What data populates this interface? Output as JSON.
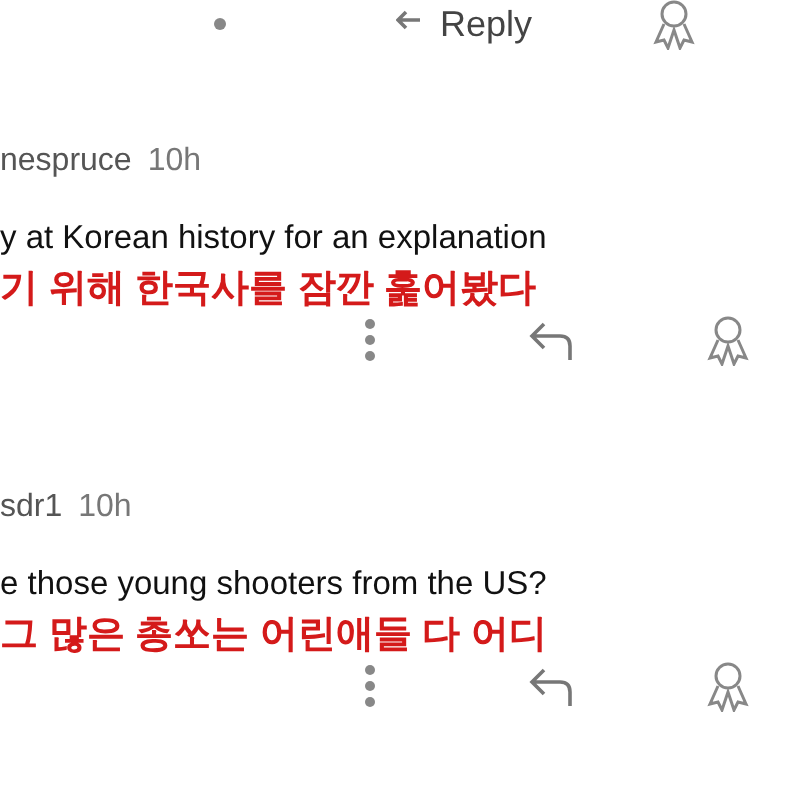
{
  "top_actions": {
    "reply_label": "Reply"
  },
  "comments": [
    {
      "username": "nespruce",
      "time": "10h",
      "body": "y at Korean history for an explanation",
      "translation": "기 위해 한국사를 잠깐 훑어봤다"
    },
    {
      "username": "sdr1",
      "time": "10h",
      "body": "e those young shooters from the US?",
      "translation": "그 많은 총쏘는 어린애들 다 어디"
    }
  ]
}
